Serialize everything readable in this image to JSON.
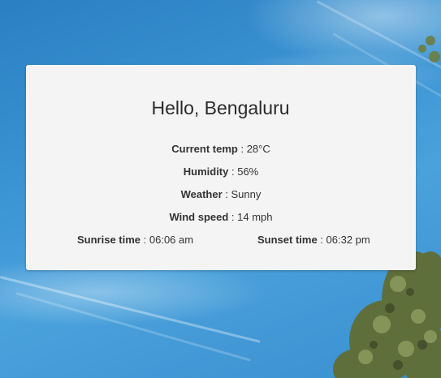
{
  "greeting": "Hello, Bengaluru",
  "details": {
    "current_temp": {
      "label": "Current temp",
      "value": "28°C"
    },
    "humidity": {
      "label": "Humidity",
      "value": "56%"
    },
    "weather": {
      "label": "Weather",
      "value": "Sunny"
    },
    "wind_speed": {
      "label": "Wind speed",
      "value": "14 mph"
    }
  },
  "sun": {
    "sunrise": {
      "label": "Sunrise time",
      "value": "06:06 am"
    },
    "sunset": {
      "label": "Sunset time",
      "value": "06:32 pm"
    }
  },
  "separator": " : ",
  "colors": {
    "sky": "#2f86c8",
    "card_bg": "#f4f4f4",
    "text": "#333333"
  }
}
